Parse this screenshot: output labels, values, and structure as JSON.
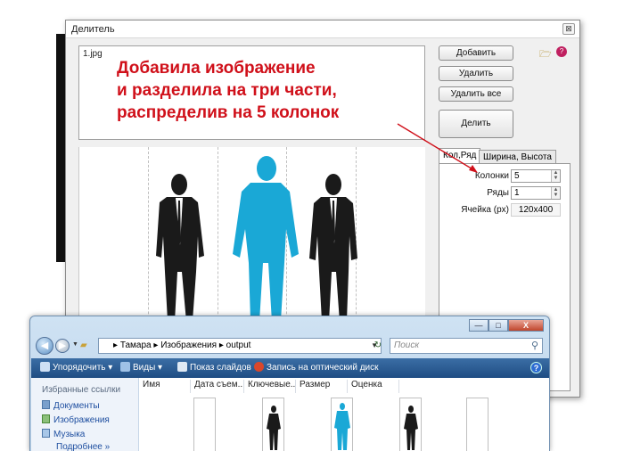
{
  "splitter": {
    "title": "Делитель",
    "close_label": "⊠",
    "file_name": "1.jpg",
    "buttons": {
      "add": "Добавить",
      "delete": "Удалить",
      "delete_all": "Удалить все",
      "split": "Делить"
    },
    "tabs": [
      "Кол,Ряд",
      "Ширина, Высота"
    ],
    "fields": {
      "columns_label": "Колонки",
      "columns_value": "5",
      "rows_label": "Ряды",
      "rows_value": "1",
      "cell_label": "Ячейка (px)",
      "cell_value": "120x400"
    }
  },
  "annotation": {
    "line1": "Добавила изображение",
    "line2": "и разделила на три части,",
    "line3": "распределив на 5 колонок"
  },
  "explorer": {
    "caption": {
      "minimize": "—",
      "maximize": "□",
      "close": "X"
    },
    "address": [
      "Тамара",
      "Изображения",
      "output"
    ],
    "address_sep": "▸",
    "search_placeholder": "Поиск",
    "toolbar": [
      "Упорядочить ▾",
      "Виды ▾",
      "Показ слайдов",
      "Запись на оптический диск"
    ],
    "help": "?",
    "left_pane": {
      "header": "Избранные ссылки",
      "items": [
        "Документы",
        "Изображения",
        "Музыка",
        "Подробнее  »"
      ]
    },
    "columns": [
      "Имя",
      "Дата съем...",
      "Ключевые...",
      "Размер",
      "Оценка"
    ]
  },
  "colors": {
    "annotation": "#d0101a",
    "figure_dark": "#1a1a1a",
    "figure_cyan": "#1aa8d6",
    "toolbar": "#2a5a92"
  }
}
